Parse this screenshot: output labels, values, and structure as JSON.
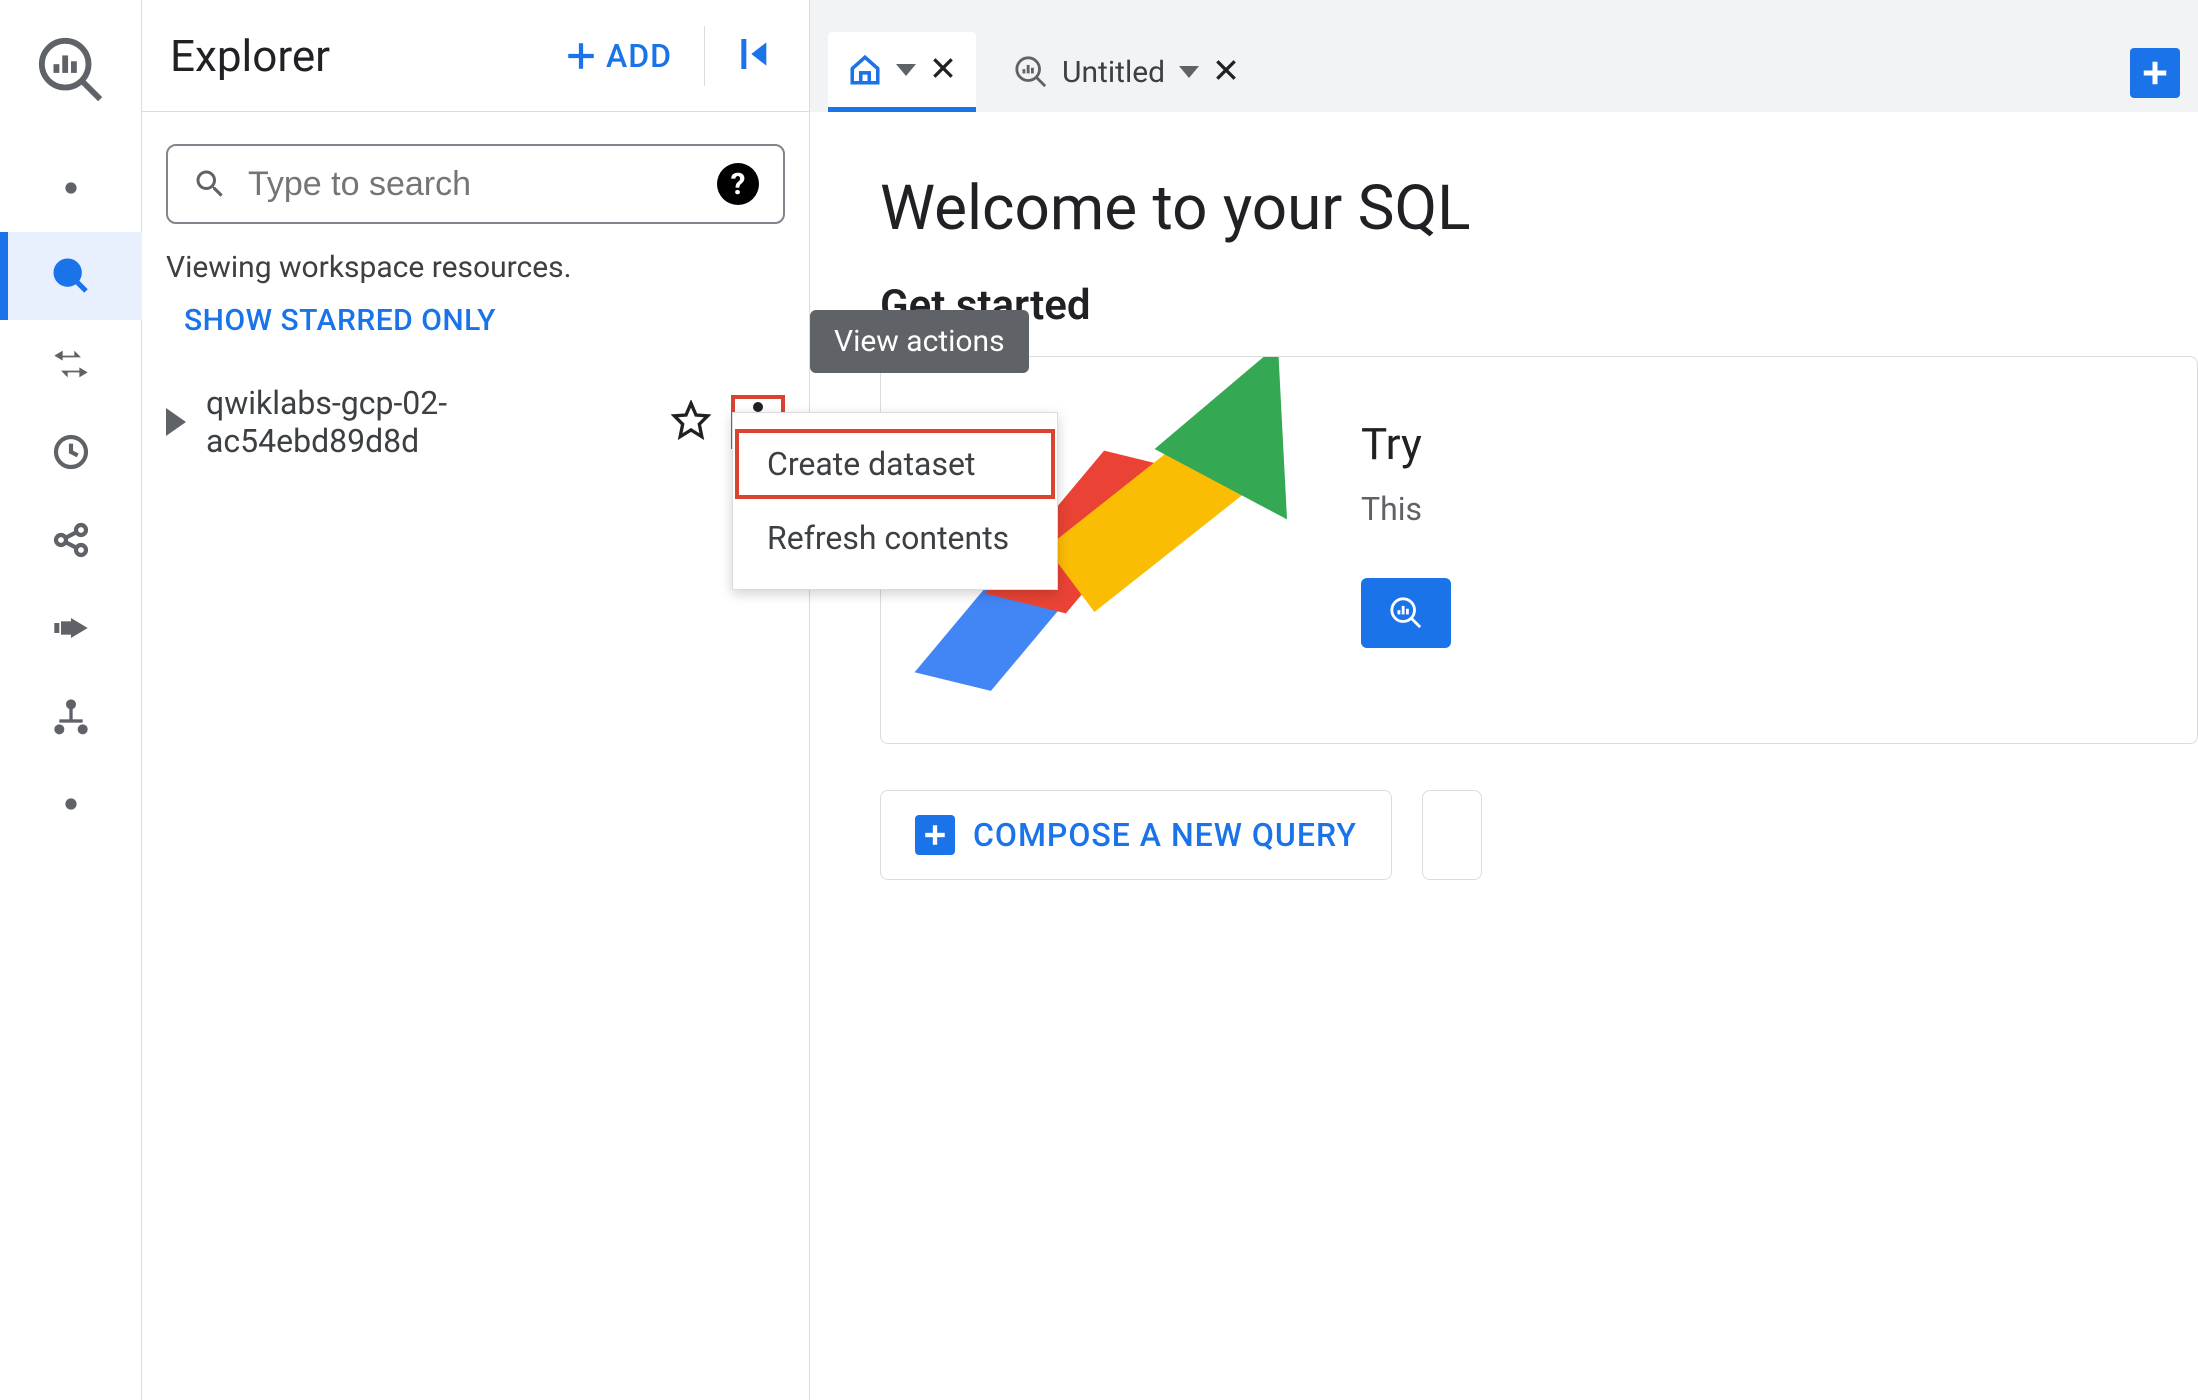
{
  "explorer": {
    "title": "Explorer",
    "add_label": "ADD",
    "search_placeholder": "Type to search",
    "viewing_label": "Viewing workspace resources.",
    "starred_label": "SHOW STARRED ONLY",
    "project_name": "qwiklabs-gcp-02-ac54ebd89d8d"
  },
  "tooltip": {
    "view_actions": "View actions"
  },
  "menu": {
    "create_dataset": "Create dataset",
    "refresh_contents": "Refresh contents"
  },
  "tabs": {
    "untitled": "Untitled"
  },
  "workspace": {
    "welcome": "Welcome to your SQL",
    "get_started": "Get started",
    "card_title": "Try",
    "card_sub": "This",
    "compose_label": "COMPOSE A NEW QUERY"
  }
}
